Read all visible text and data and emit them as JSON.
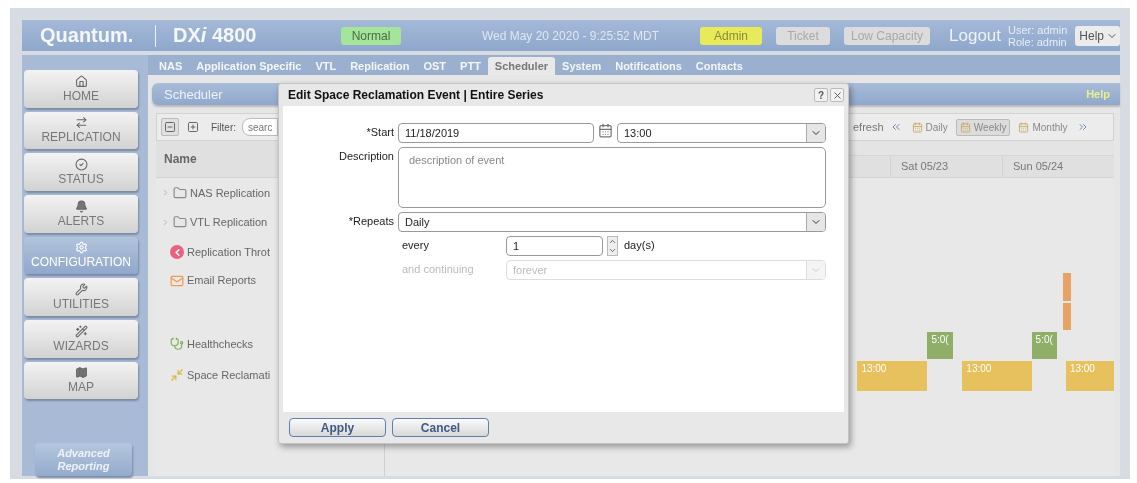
{
  "header": {
    "brand": "Quantum.",
    "product_prefix": "DX",
    "product_italic": "i",
    "product_suffix": " 4800",
    "status": "Normal",
    "datetime": "Wed May 20 2020 - 9:25:52 MDT",
    "badges": [
      {
        "label": "Admin",
        "active": true
      },
      {
        "label": "Ticket",
        "active": false
      },
      {
        "label": "Low Capacity",
        "active": false
      }
    ],
    "logout": "Logout",
    "user": "User: admin",
    "role": "Role: admin",
    "help_menu": "Help"
  },
  "tabs": [
    {
      "label": "NAS",
      "selected": false
    },
    {
      "label": "Application Specific",
      "selected": false
    },
    {
      "label": "VTL",
      "selected": false
    },
    {
      "label": "Replication",
      "selected": false
    },
    {
      "label": "OST",
      "selected": false
    },
    {
      "label": "PTT",
      "selected": false
    },
    {
      "label": "Scheduler",
      "selected": true
    },
    {
      "label": "System",
      "selected": false
    },
    {
      "label": "Notifications",
      "selected": false
    },
    {
      "label": "Contacts",
      "selected": false
    }
  ],
  "sidebar": {
    "items": [
      {
        "label": "HOME",
        "selected": false
      },
      {
        "label": "REPLICATION",
        "selected": false
      },
      {
        "label": "STATUS",
        "selected": false
      },
      {
        "label": "ALERTS",
        "selected": false
      },
      {
        "label": "CONFIGURATION",
        "selected": true
      },
      {
        "label": "UTILITIES",
        "selected": false
      },
      {
        "label": "WIZARDS",
        "selected": false
      },
      {
        "label": "MAP",
        "selected": false
      }
    ],
    "reporting": [
      "Advanced",
      "Reporting"
    ]
  },
  "panel": {
    "title": "Scheduler",
    "help": "Help",
    "toolbar": {
      "filter_label": "Filter:",
      "filter_placeholder": "searc",
      "refresh": "efresh",
      "views": [
        {
          "label": "Daily",
          "selected": false
        },
        {
          "label": "Weekly",
          "selected": true
        },
        {
          "label": "Monthly",
          "selected": false
        }
      ]
    },
    "name_column": "Name",
    "days": [
      "Sat 05/23",
      "Sun 05/24"
    ],
    "rows": [
      {
        "name": "NAS Replication",
        "expandable": true,
        "events": []
      },
      {
        "name": "VTL Replication",
        "expandable": true,
        "events": []
      },
      {
        "name": "Replication Throt",
        "expandable": false,
        "events": []
      },
      {
        "name": "Email Reports",
        "expandable": false,
        "events": [
          {
            "color": "#e8a264"
          },
          {
            "color": "#e8a264"
          }
        ]
      },
      {
        "name": "Healthchecks",
        "expandable": false,
        "events": [
          {
            "label": "5:0(",
            "color": "#8fae68"
          },
          {
            "label": "5:0(",
            "color": "#8fae68"
          }
        ]
      },
      {
        "name": "Space Reclamati",
        "expandable": false,
        "events": [
          {
            "label": "13:00",
            "color": "#e7c15e"
          },
          {
            "label": "13:00",
            "color": "#e7c15e"
          },
          {
            "label": "13:00",
            "color": "#e7c15e"
          }
        ]
      }
    ]
  },
  "dialog": {
    "title": "Edit Space Reclamation Event | Entire Series",
    "help": "?",
    "start_label": "*Start",
    "start_date": "11/18/2019",
    "start_time": "13:00",
    "description_label": "Description",
    "description_placeholder": "description of event",
    "repeats_label": "*Repeats",
    "repeats": "Daily",
    "every_label": "every",
    "every_value": "1",
    "every_unit": "day(s)",
    "continuing_label": "and continuing",
    "continuing_value": "forever",
    "continuing_disabled": true,
    "buttons": [
      "Apply",
      "Cancel"
    ]
  }
}
